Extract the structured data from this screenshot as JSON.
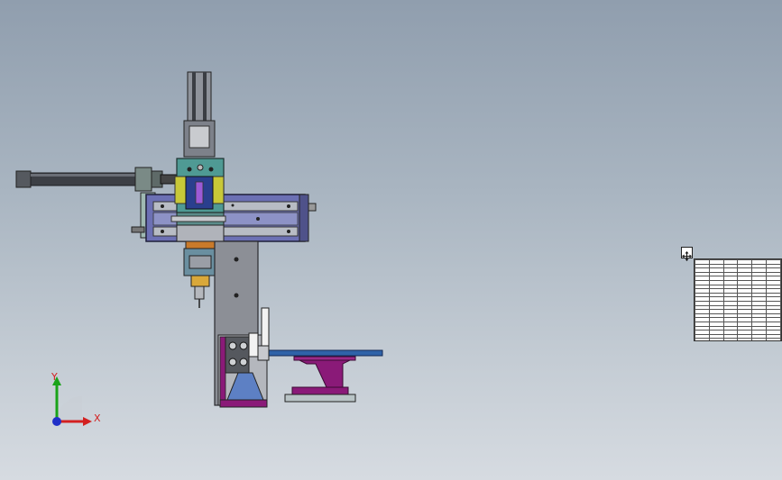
{
  "viewport": {
    "background_top": "#909eae",
    "background_bottom": "#d6dbe1"
  },
  "triad": {
    "x_label": "X",
    "y_label": "Y",
    "x_color": "#d32020",
    "y_color": "#19a319",
    "z_color": "#2030c8"
  },
  "bom_table": {
    "rows": 24,
    "columns": 6,
    "move_handle_icon": "move-icon"
  },
  "colors": {
    "frame": "#6c70b4",
    "plate_teal": "#4f9a94",
    "plate_yellow": "#c8c838",
    "plate_magenta": "#8a1a78",
    "arm_blue": "#2f62a8",
    "cylinder": "#3c3f45",
    "column": "#8c8f96"
  }
}
